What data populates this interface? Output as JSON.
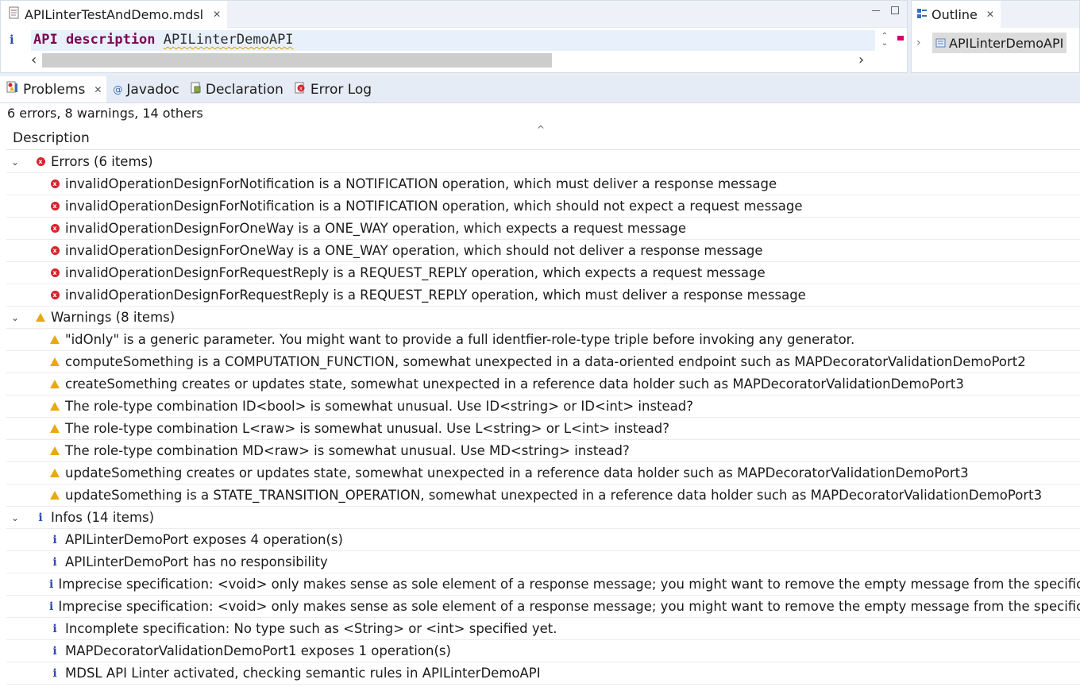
{
  "editor": {
    "tab_label": "APILinterTestAndDemo.mdsl",
    "code_keyword": "API description",
    "code_name": "APILinterDemoAPI"
  },
  "outline": {
    "tab_label": "Outline",
    "item_label": "APILinterDemoAPI"
  },
  "problems_view": {
    "tabs": [
      {
        "label": "Problems",
        "active": true
      },
      {
        "label": "Javadoc",
        "active": false
      },
      {
        "label": "Declaration",
        "active": false
      },
      {
        "label": "Error Log",
        "active": false
      }
    ],
    "summary": "6 errors, 8 warnings, 14 others",
    "column_header": "Description",
    "groups": [
      {
        "label": "Errors (6 items)",
        "icon": "error-icon",
        "items": [
          "invalidOperationDesignForNotification is a NOTIFICATION operation, which must deliver a response message",
          "invalidOperationDesignForNotification is a NOTIFICATION operation, which should not expect a request message",
          "invalidOperationDesignForOneWay is a ONE_WAY operation, which expects a request message",
          "invalidOperationDesignForOneWay is a ONE_WAY operation, which should not deliver a response message",
          "invalidOperationDesignForRequestReply is a REQUEST_REPLY operation, which expects a request message",
          "invalidOperationDesignForRequestReply is a REQUEST_REPLY operation, which must deliver a response message"
        ]
      },
      {
        "label": "Warnings (8 items)",
        "icon": "warning-icon",
        "items": [
          "\"idOnly\" is a generic parameter. You might want to provide a full identfier-role-type triple before invoking any generator.",
          "computeSomething is a COMPUTATION_FUNCTION, somewhat unexpected in a data-oriented endpoint such as MAPDecoratorValidationDemoPort2",
          "createSomething creates or updates state, somewhat unexpected in a reference data holder such as MAPDecoratorValidationDemoPort3",
          "The role-type combination ID<bool> is somewhat unusual. Use ID<string> or ID<int> instead?",
          "The role-type combination L<raw> is somewhat unusual. Use L<string> or L<int> instead?",
          "The role-type combination MD<raw> is somewhat unusual. Use MD<string> instead?",
          "updateSomething creates or updates state, somewhat unexpected in a reference data holder such as MAPDecoratorValidationDemoPort3",
          "updateSomething is a STATE_TRANSITION_OPERATION, somewhat unexpected in a reference data holder such as MAPDecoratorValidationDemoPort3"
        ]
      },
      {
        "label": "Infos (14 items)",
        "icon": "info-icon",
        "items": [
          "APILinterDemoPort exposes 4 operation(s)",
          "APILinterDemoPort has no responsibility",
          "Imprecise specification: <void> only makes sense as sole element of a response message; you might want to remove the empty message from the specification.",
          "Imprecise specification: <void> only makes sense as sole element of a response message; you might want to remove the empty message from the specification.",
          "Incomplete specification: No type such as <String> or <int> specified yet.",
          "MAPDecoratorValidationDemoPort1 exposes 1 operation(s)",
          "MDSL API Linter activated, checking semantic rules in APILinterDemoAPI"
        ]
      }
    ]
  }
}
